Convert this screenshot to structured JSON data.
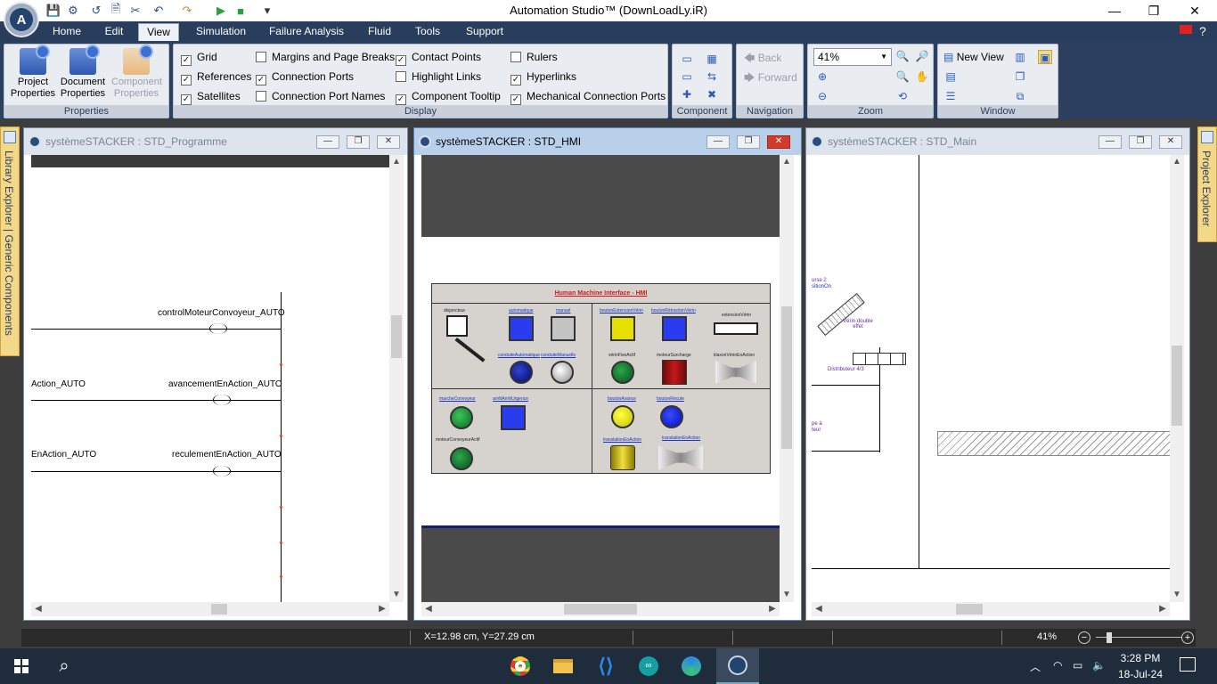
{
  "app": {
    "title": "Automation Studio™ (DownLoadLy.iR)"
  },
  "window_controls": {
    "minimize": "—",
    "maximize": "❐",
    "close": "✕"
  },
  "menu": {
    "tabs": [
      "Home",
      "Edit",
      "View",
      "Simulation",
      "Failure Analysis",
      "Fluid",
      "Tools",
      "Support"
    ],
    "active": "View"
  },
  "ribbon": {
    "properties": {
      "label": "Properties",
      "buttons": [
        "Project Properties",
        "Document Properties",
        "Component Properties"
      ]
    },
    "display": {
      "label": "Display",
      "checkboxes": [
        {
          "label": "Grid",
          "checked": true
        },
        {
          "label": "References",
          "checked": true
        },
        {
          "label": "Satellites",
          "checked": true
        },
        {
          "label": "Margins and Page Breaks",
          "checked": false
        },
        {
          "label": "Connection Ports",
          "checked": true
        },
        {
          "label": "Connection Port Names",
          "checked": false
        },
        {
          "label": "Contact Points",
          "checked": true
        },
        {
          "label": "Highlight Links",
          "checked": false
        },
        {
          "label": "Component Tooltip",
          "checked": true
        },
        {
          "label": "Rulers",
          "checked": false
        },
        {
          "label": "Hyperlinks",
          "checked": true
        },
        {
          "label": "Mechanical Connection Ports",
          "checked": true
        }
      ]
    },
    "component": {
      "label": "Component"
    },
    "navigation": {
      "label": "Navigation",
      "back": "Back",
      "forward": "Forward"
    },
    "zoom": {
      "label": "Zoom",
      "value": "41%"
    },
    "window": {
      "label": "Window",
      "new_view": "New View"
    }
  },
  "side_tabs": {
    "left": "Library Explorer | Generic Components",
    "right": "Project Explorer"
  },
  "windows": [
    {
      "title": "systèmeSTACKER : STD_Programme",
      "active": false
    },
    {
      "title": "systèmeSTACKER : STD_HMI",
      "active": true
    },
    {
      "title": "systèmeSTACKER : STD_Main",
      "active": false
    }
  ],
  "ladder": {
    "rungs": [
      {
        "left": "",
        "right": "controlMoteurConvoyeur_AUTO"
      },
      {
        "left": "Action_AUTO",
        "right": "avancementEnAction_AUTO"
      },
      {
        "left": "EnAction_AUTO",
        "right": "reculementEnAction_AUTO"
      }
    ]
  },
  "hmi": {
    "title": "Human Machine Interface - HMI",
    "labels": {
      "disjoncteur": "disjoncteur",
      "automatique": "automatique",
      "manuel": "manuel",
      "conduiteAutomatique": "conduiteAutomatique",
      "conduiteManuelle": "conduiteManuelle",
      "boutonExtensionVerin": "boutonExtensionVérin",
      "boutonRetractionVerin": "boutonRétractionVérin",
      "extensionVerin": "extensionVérin",
      "verinFixeActif": "vérinFixeActif",
      "moteurSurcharge": "moteurSurcharge",
      "klaxonVerinEnAction": "klaxonVérinEnAction",
      "marcheConvoyeur": "marcheConvoyeur",
      "arretArretUrgence": "arrêtArrêtUrgence",
      "moteurConvoyeurActif": "moteurConvoyeurActif",
      "boutonAvance": "boutonAvance",
      "boutonRecule": "boutonRecule",
      "translationEnAction1": "translationEnAction",
      "translationEnAction2": "translationEnAction"
    }
  },
  "main_diagram": {
    "labels": {
      "course": "urse 2",
      "position": "sitionOn",
      "verin": "Vérin double effet",
      "distributeur": "Distributeur 4/3",
      "pompe": "pe à",
      "moteur": "teur"
    }
  },
  "status": {
    "coordinates": "X=12.98 cm, Y=27.29 cm",
    "zoom": "41%"
  },
  "taskbar": {
    "time": "3:28 PM",
    "date": "18-Jul-24"
  },
  "colors": {
    "menubar": "#293d5c",
    "active_window": "#b9d0ea",
    "hmi_panel": "#d6d3ce"
  }
}
